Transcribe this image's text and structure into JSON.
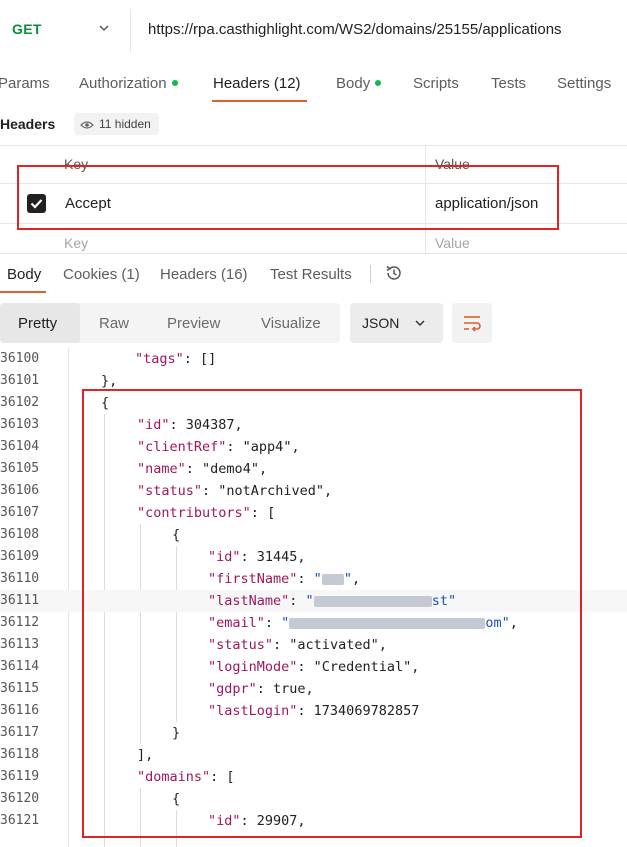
{
  "request": {
    "method": "GET",
    "url": "https://rpa.casthighlight.com/WS2/domains/25155/applications"
  },
  "request_tabs": [
    {
      "label": "Params",
      "dot": false
    },
    {
      "label": "Authorization",
      "dot": true
    },
    {
      "label": "Headers (12)",
      "dot": false
    },
    {
      "label": "Body",
      "dot": true
    },
    {
      "label": "Scripts",
      "dot": false
    },
    {
      "label": "Tests",
      "dot": false
    },
    {
      "label": "Settings",
      "dot": false
    }
  ],
  "headers_section": {
    "title": "Headers",
    "hidden_label": "11 hidden",
    "col_key": "Key",
    "col_value": "Value",
    "rows": [
      {
        "key": "Accept",
        "value": "application/json",
        "checked": true
      }
    ],
    "key_placeholder": "Key",
    "value_placeholder": "Value"
  },
  "response_tabs": [
    "Body",
    "Cookies (1)",
    "Headers (16)",
    "Test Results"
  ],
  "view_modes": [
    "Pretty",
    "Raw",
    "Preview",
    "Visualize"
  ],
  "format": "JSON",
  "accent_color": "#e05f2a",
  "highlight_color": "#e02424",
  "code_lines": [
    {
      "ln": "36100",
      "t": "\"tags\": []"
    },
    {
      "ln": "36101",
      "t": "},"
    },
    {
      "ln": "36102",
      "t": "{"
    },
    {
      "ln": "36103",
      "t": "\"id\": 304387,"
    },
    {
      "ln": "36104",
      "t": "\"clientRef\": \"app4\","
    },
    {
      "ln": "36105",
      "t": "\"name\": \"demo4\","
    },
    {
      "ln": "36106",
      "t": "\"status\": \"notArchived\","
    },
    {
      "ln": "36107",
      "t": "\"contributors\": ["
    },
    {
      "ln": "36108",
      "t": "{"
    },
    {
      "ln": "36109",
      "t": "\"id\": 31445,"
    },
    {
      "ln": "36110",
      "t": "\"firstName\": \"\","
    },
    {
      "ln": "36111",
      "t": "\"lastName\": \"st\""
    },
    {
      "ln": "36112",
      "t": "\"email\": \"om\","
    },
    {
      "ln": "36113",
      "t": "\"status\": \"activated\","
    },
    {
      "ln": "36114",
      "t": "\"loginMode\": \"Credential\","
    },
    {
      "ln": "36115",
      "t": "\"gdpr\": true,"
    },
    {
      "ln": "36116",
      "t": "\"lastLogin\": 1734069782857"
    },
    {
      "ln": "36117",
      "t": "}"
    },
    {
      "ln": "36118",
      "t": "],"
    },
    {
      "ln": "36119",
      "t": "\"domains\": ["
    },
    {
      "ln": "36120",
      "t": "{"
    },
    {
      "ln": "36121",
      "t": "\"id\": 29907,"
    }
  ]
}
